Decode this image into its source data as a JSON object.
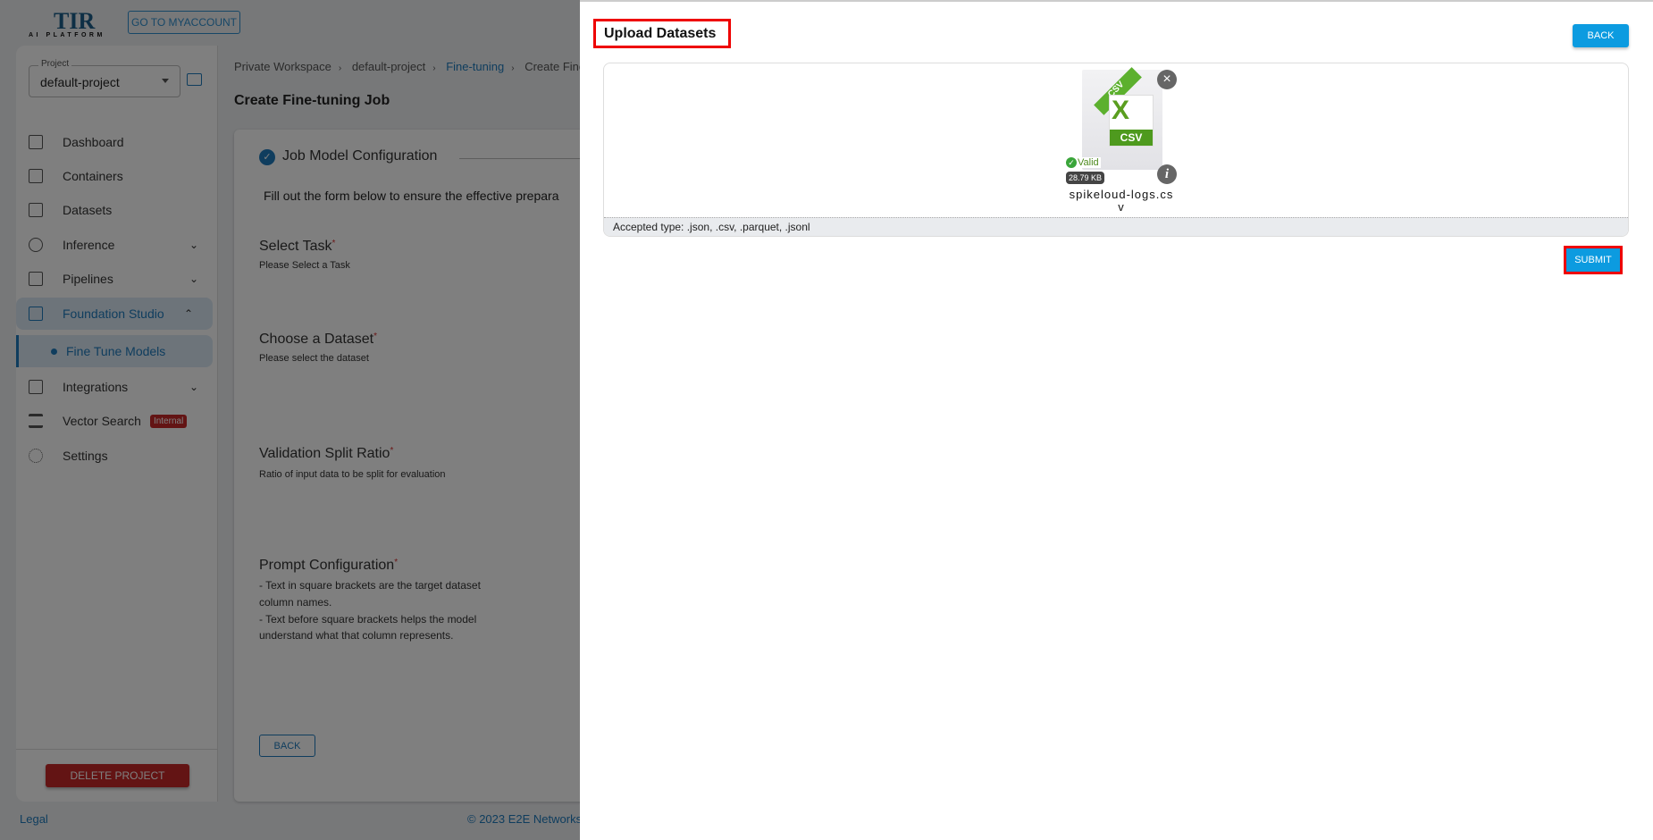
{
  "header": {
    "logo_title": "TIR",
    "logo_sub": "AI PLATFORM",
    "myaccount_label": "GO TO MYACCOUNT"
  },
  "sidebar": {
    "project_label": "Project",
    "project_value": "default-project",
    "items": [
      {
        "label": "Dashboard"
      },
      {
        "label": "Containers"
      },
      {
        "label": "Datasets"
      },
      {
        "label": "Inference"
      },
      {
        "label": "Pipelines"
      },
      {
        "label": "Foundation Studio"
      },
      {
        "label": "Fine Tune Models"
      },
      {
        "label": "Integrations"
      },
      {
        "label": "Vector Search",
        "badge": "Internal"
      },
      {
        "label": "Settings"
      }
    ],
    "delete_label": "DELETE PROJECT"
  },
  "breadcrumb": [
    "Private Workspace",
    "default-project",
    "Fine-tuning",
    "Create Fine"
  ],
  "page_title": "Create Fine-tuning Job",
  "form": {
    "step_title": "Job Model Configuration",
    "intro": "Fill out the form below to ensure the effective prepara",
    "select_task": {
      "label": "Select Task",
      "hint": "Please Select a Task"
    },
    "dataset": {
      "label": "Choose a Dataset",
      "hint": "Please select the dataset"
    },
    "split": {
      "label": "Validation Split Ratio",
      "hint": "Ratio of input data to be split for evaluation"
    },
    "prompt": {
      "label": "Prompt Configuration",
      "lines": [
        "- Text in square brackets are the target dataset",
        "column names.",
        "- Text before square brackets helps the model",
        "understand what that column represents."
      ]
    },
    "back_label": "BACK"
  },
  "footer": {
    "legal": "Legal",
    "copyright": "© 2023 E2E Networks"
  },
  "drawer": {
    "title": "Upload Datasets",
    "back_label": "BACK",
    "file": {
      "ribbon": "CSV",
      "type": "CSV",
      "status": "Valid",
      "size": "28.79 KB",
      "name": "spikeloud-logs.csv"
    },
    "accepted": "Accepted type: .json, .csv, .parquet, .jsonl",
    "submit_label": "SUBMIT"
  },
  "colors": {
    "accent": "#0c9be0",
    "highlight": "#ee0000",
    "danger": "#c62828",
    "valid": "#3aa53a"
  }
}
